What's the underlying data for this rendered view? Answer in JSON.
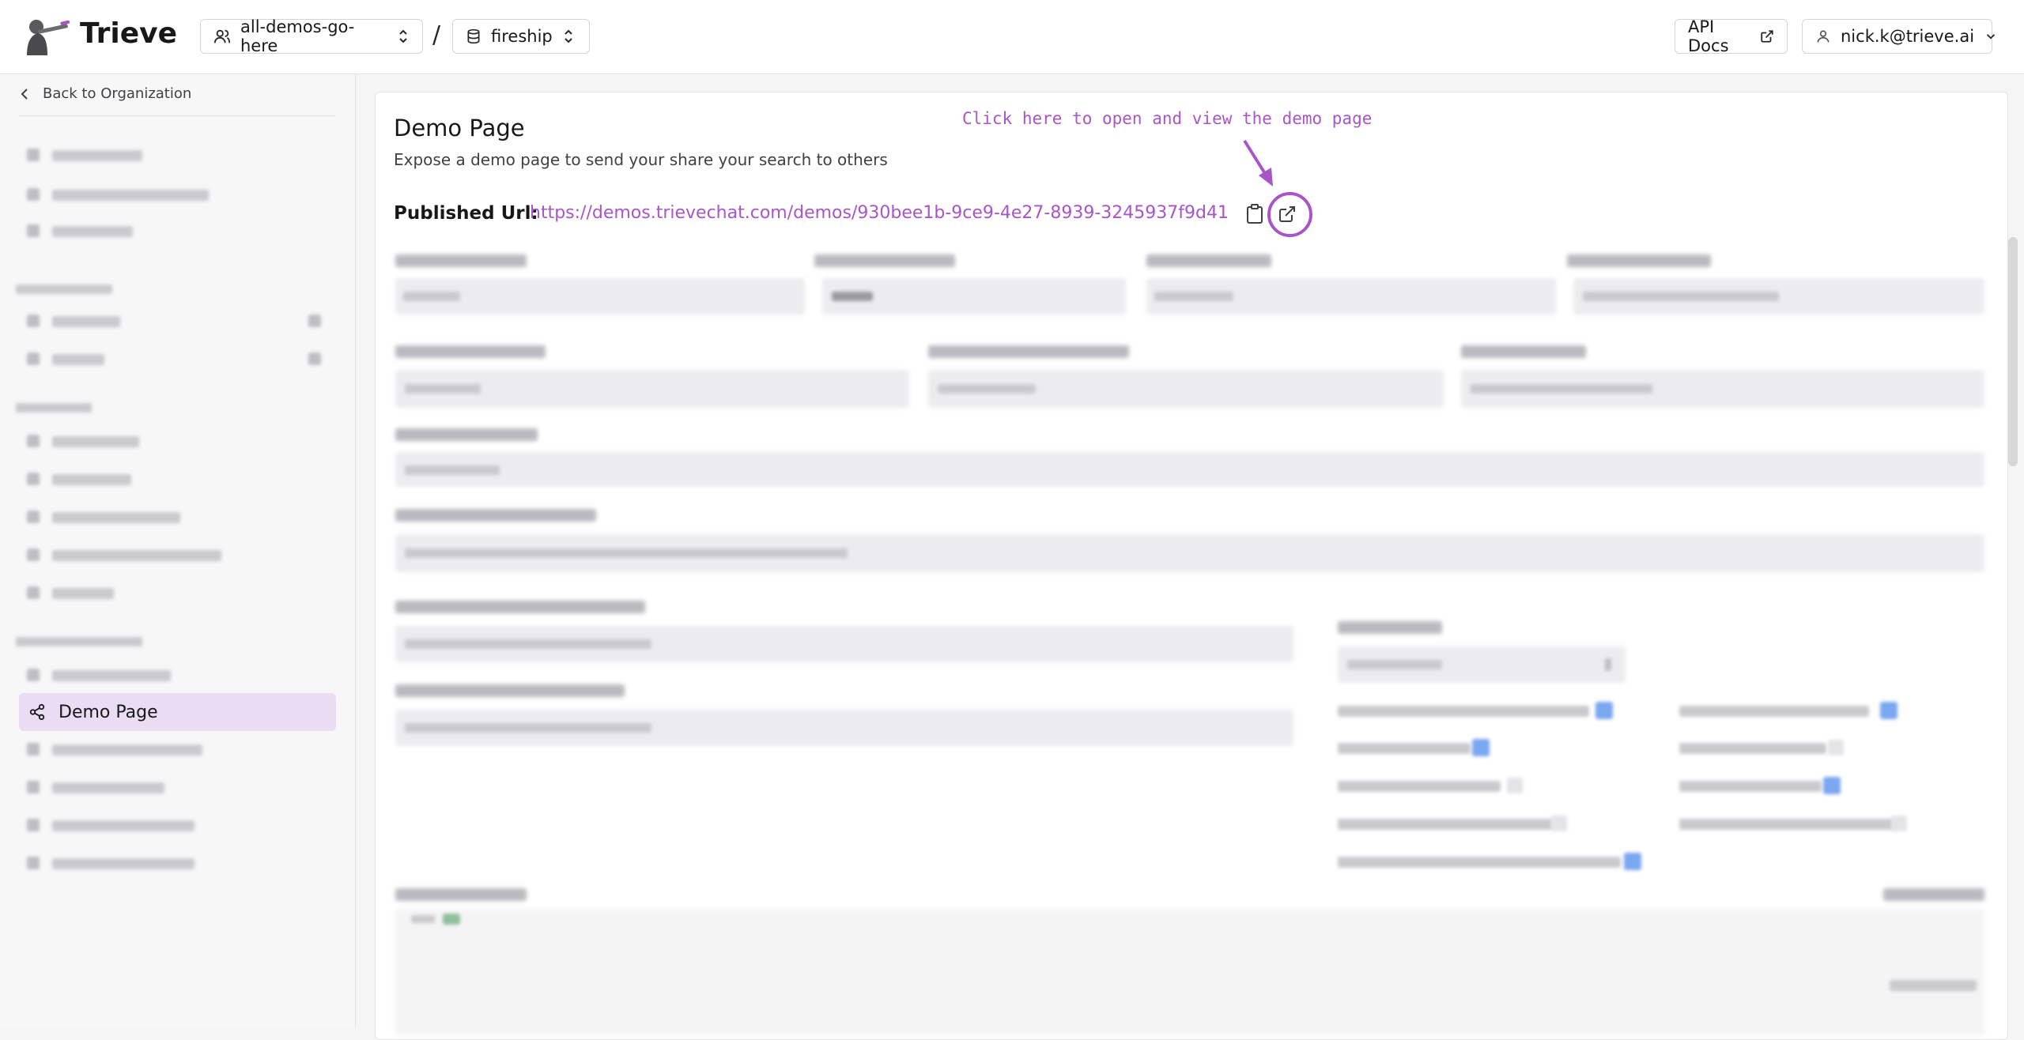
{
  "app": {
    "brand": "Trieve"
  },
  "header": {
    "organization": "all-demos-go-here",
    "separator": "/",
    "dataset": "fireship",
    "api_docs": "API Docs",
    "user_email": "nick.k@trieve.ai"
  },
  "sidebar": {
    "back_label": "Back to Organization",
    "active_item": "Demo Page"
  },
  "main": {
    "title": "Demo Page",
    "subtitle": "Expose a demo page to send your share your search to others",
    "annotation": "Click here to open and view the demo page",
    "published_url_label": "Published Url:",
    "published_url": "https://demos.trievechat.com/demos/930bee1b-9ce9-4e27-8939-3245937f9d41"
  },
  "colors": {
    "accent": "#a855c7",
    "active_bg": "#eadcf2"
  },
  "icons": [
    "logo-icon",
    "users-icon",
    "chevron-updown-icon",
    "database-icon",
    "external-link-icon",
    "user-icon",
    "chevron-down-icon",
    "chevron-left-icon",
    "share-icon",
    "clipboard-icon",
    "arrow-icon"
  ]
}
